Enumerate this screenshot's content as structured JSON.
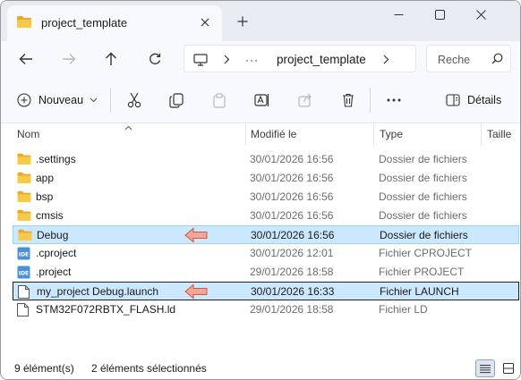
{
  "tab": {
    "title": "project_template"
  },
  "address": {
    "path": "project_template",
    "ellipsis": "···"
  },
  "search": {
    "placeholder": "Reche"
  },
  "toolbar": {
    "new_label": "Nouveau",
    "details_label": "Détails"
  },
  "columns": {
    "name": "Nom",
    "modified": "Modifié le",
    "type": "Type",
    "size": "Taille"
  },
  "rows": [
    {
      "name": ".settings",
      "date": "30/01/2026 16:56",
      "type": "Dossier de fichiers",
      "icon": "folder-icon"
    },
    {
      "name": "app",
      "date": "30/01/2026 16:56",
      "type": "Dossier de fichiers",
      "icon": "folder-icon"
    },
    {
      "name": "bsp",
      "date": "30/01/2026 16:56",
      "type": "Dossier de fichiers",
      "icon": "folder-icon"
    },
    {
      "name": "cmsis",
      "date": "30/01/2026 16:56",
      "type": "Dossier de fichiers",
      "icon": "folder-icon"
    },
    {
      "name": "Debug",
      "date": "30/01/2026 16:56",
      "type": "Dossier de fichiers",
      "icon": "folder-icon",
      "selected": true
    },
    {
      "name": ".cproject",
      "date": "30/01/2026 12:01",
      "type": "Fichier CPROJECT",
      "icon": "ide-file-icon"
    },
    {
      "name": ".project",
      "date": "29/01/2026 18:58",
      "type": "Fichier PROJECT",
      "icon": "ide-file-icon"
    },
    {
      "name": "my_project Debug.launch",
      "date": "30/01/2026 16:33",
      "type": "Fichier LAUNCH",
      "icon": "document-icon",
      "selected": true
    },
    {
      "name": "STM32F072RBTX_FLASH.ld",
      "date": "29/01/2026 18:58",
      "type": "Fichier LD",
      "icon": "document-icon"
    }
  ],
  "status": {
    "count": "9 élément(s)",
    "selection": "2 éléments sélectionnés"
  },
  "colors": {
    "selection_bg": "#cce8ff",
    "accent": "#0067c0",
    "folder": "#f4c142",
    "annotation_arrow": "#f3a79a"
  }
}
